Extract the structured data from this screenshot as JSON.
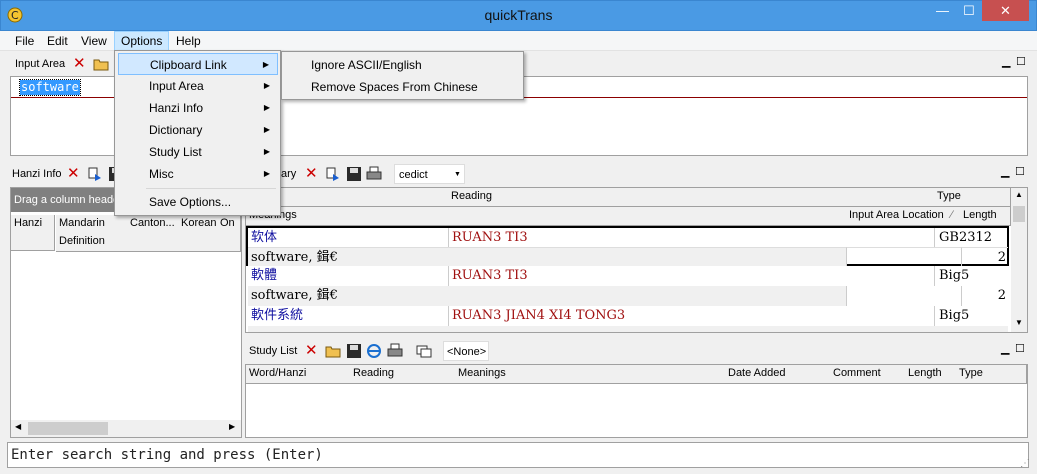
{
  "window": {
    "title": "quickTrans",
    "minimize": "—",
    "maximize": "☐",
    "close": "✕"
  },
  "menubar": {
    "items": [
      "File",
      "Edit",
      "View",
      "Options",
      "Help"
    ]
  },
  "input_area": {
    "label": "Input Area",
    "text": "software"
  },
  "options_menu": {
    "items": [
      {
        "label": "Clipboard Link",
        "arrow": "▶"
      },
      {
        "label": "Input Area",
        "arrow": "▶"
      },
      {
        "label": "Hanzi Info",
        "arrow": "▶"
      },
      {
        "label": "Dictionary",
        "arrow": "▶"
      },
      {
        "label": "Study List",
        "arrow": "▶"
      },
      {
        "label": "Misc",
        "arrow": "▶"
      },
      {
        "label": "Save Options...",
        "arrow": ""
      }
    ]
  },
  "clipboard_submenu": {
    "items": [
      "Ignore ASCII/English",
      "Remove Spaces From Chinese"
    ]
  },
  "hanzi_info": {
    "label": "Hanzi Info",
    "drag_hint": "Drag a column heade",
    "columns": [
      "Hanzi",
      "Mandarin",
      "Canton...",
      "Korean",
      "On"
    ],
    "sub_column": "Definition"
  },
  "dictionary": {
    "label": "ary",
    "selected": "cedict",
    "header_row1": [
      "",
      "Reading",
      "Type"
    ],
    "header_row2": [
      "Meanings",
      "Input Area Location",
      "Length"
    ],
    "sort_mark": "∕",
    "rows": [
      {
        "word": "软体",
        "reading": "RUAN3 TI3",
        "type": "GB2312",
        "meanings": "software, 鍓€",
        "length": "2"
      },
      {
        "word": "軟體",
        "reading": "RUAN3 TI3",
        "type": "Big5",
        "meanings": "software, 鍓€",
        "length": "2"
      },
      {
        "word": "軟件系統",
        "reading": "RUAN3 JIAN4 XI4 TONG3",
        "type": "Big5",
        "meanings": "",
        "length": ""
      }
    ]
  },
  "study_list": {
    "label": "Study List",
    "selected": "<None>",
    "columns": [
      "Word/Hanzi",
      "Reading",
      "Meanings",
      "Date Added",
      "Comment",
      "Length",
      "Type"
    ]
  },
  "status": {
    "text": "Enter search string and press (Enter)"
  },
  "colors": {
    "titlebar": "#4a9ae4",
    "close": "#c75050",
    "selection": "#3399ff",
    "reading_red": "#a01010",
    "word_blue": "#1010a0"
  }
}
